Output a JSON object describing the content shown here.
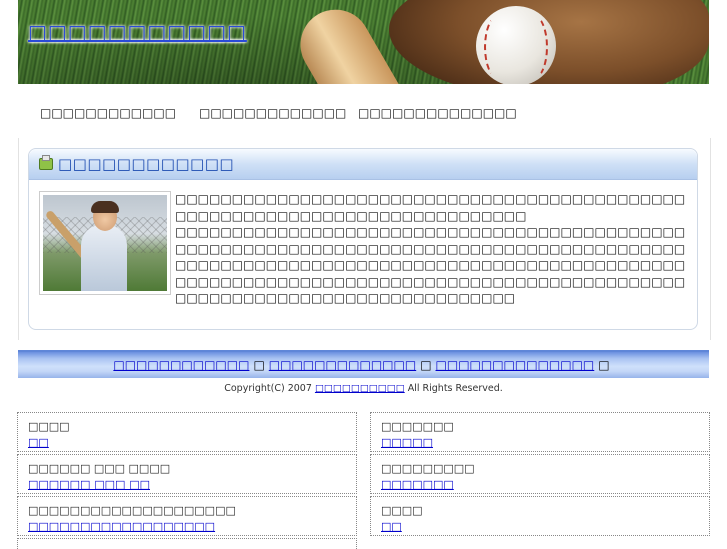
{
  "header": {
    "site_title": "□□□□□□□□□□□"
  },
  "topnav": [
    {
      "label": "□□□□□□□□□□□□"
    },
    {
      "label": "□□□□□□□□□□□□□"
    },
    {
      "label": "□□□□□□□□□□□□□□"
    }
  ],
  "panel": {
    "title": "□□□□□□□□□□□□",
    "paragraphs": [
      "□□□□□□□□□□□□□□□□□□□□□□□□□□□□□□□□□□□□□□□□□□□□□□□□□□□□□□□□□□□□□□□□□□□□□□□□□□□□",
      "□□□□□□□□□□□□□□□□□□□□□□□□□□□□□□□□□□□□□□□□□□□□□□□□□□□□□□□□□□□□□□□□□□□□□□□□□□□□□□□□□□□□□□□□□□□□□□□□□□□□□□□□□□□□□□□□□□□□□□□□□□□□□□□□□□□□□□□□□□□□□□□□□□□□□□□□□□□□□□□□□□□□□□□□□□□□□□□□□□□□□□□□□□□□□□□□□□□□□□□□□□□□□□□□□□"
    ]
  },
  "footer": {
    "links": [
      {
        "label": "□□□□□□□□□□□□"
      },
      {
        "label": "□□□□□□□□□□□□□"
      },
      {
        "label": "□□□□□□□□□□□□□□"
      }
    ],
    "separator": "□",
    "copyright_prefix": "Copyright(C) 2007",
    "copyright_link": "□□□□□□□□□□",
    "copyright_suffix": "All Rights Reserved."
  },
  "bottom_grid": [
    {
      "label": "□□□□",
      "link": "□□"
    },
    {
      "label": "□□□□□□□",
      "link": "□□□□□"
    },
    {
      "label": "□□□□□□ □□□ □□□□",
      "link": "□□□□□□ □□□ □□"
    },
    {
      "label": "□□□□□□□□□",
      "link": "□□□□□□□"
    },
    {
      "label": "□□□□□□□□□□□□□□□□□□□□",
      "link": "□□□□□□□□□□□□□□□□□□"
    },
    {
      "label": "□□□□",
      "link": "□□"
    }
  ]
}
